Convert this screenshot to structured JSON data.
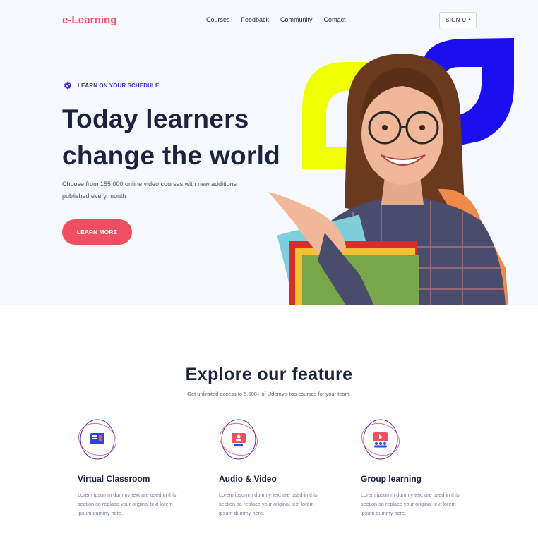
{
  "brand": {
    "logo": "e-Learning",
    "accent": "#ef4f61"
  },
  "nav": {
    "items": [
      "Courses",
      "Feedback",
      "Community",
      "Contact"
    ],
    "signup": "SIGN UP"
  },
  "hero": {
    "tagline": "LEARN ON YOUR SCHEDULE",
    "headline_line1": "Today learners",
    "headline_line2": "change the world",
    "subtitle": "Choose from 155,000 online video courses with new additions published every month",
    "cta": "LEARN MORE",
    "image": "smiling-student-holding-books"
  },
  "features_section": {
    "title": "Explore our feature",
    "subtitle": "Get unlimited access to 5,500+ of Udemy's top courses for your team.",
    "items": [
      {
        "title": "Virtual Classroom",
        "text": "Lorem ipsumm dummy text are used in this section so replace your original text lorem ipsum dummy here.",
        "icon": "classroom-icon"
      },
      {
        "title": "Audio & Video",
        "text": "Lorem ipsumm dummy text are used in this section so replace your original text lorem ipsum dummy here.",
        "icon": "video-icon"
      },
      {
        "title": "Group learning",
        "text": "Lorem ipsumm dummy text are used in this section so replace your original text lorem ipsum dummy here.",
        "icon": "group-icon"
      }
    ]
  },
  "colors": {
    "navy": "#1c2340",
    "blue": "#1b0ff0",
    "yellow": "#f0ff00",
    "coral": "#ef4f61",
    "hero_bg": "#f5f8fd"
  }
}
